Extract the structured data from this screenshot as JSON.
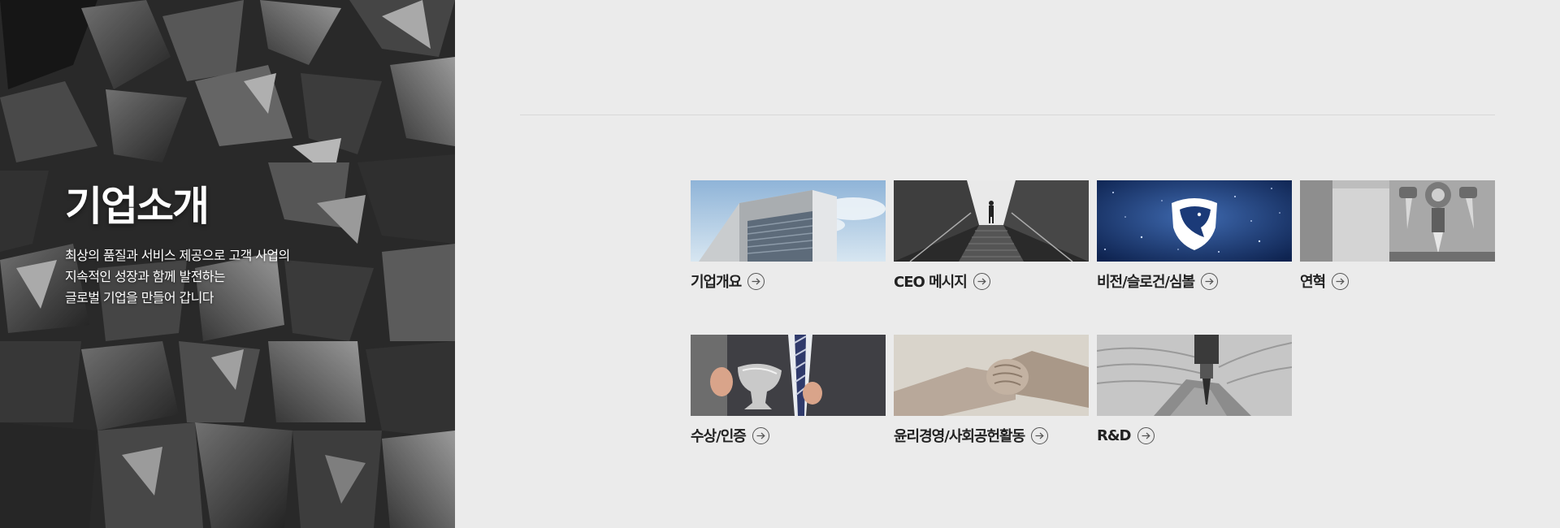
{
  "hero": {
    "title": "기업소개",
    "description_lines": [
      "최상의 품질과 서비스 제공으로 고객 사업의",
      "지속적인 성장과 함께 발전하는",
      "글로벌 기업을 만들어 갑니다"
    ]
  },
  "menu": {
    "items": [
      {
        "label": "기업개요",
        "image": "building-exterior"
      },
      {
        "label": "CEO 메시지",
        "image": "person-on-stairs"
      },
      {
        "label": "비전/슬로건/심볼",
        "image": "panther-shield-symbol"
      },
      {
        "label": "연혁",
        "image": "machining-tool"
      },
      {
        "label": "수상/인증",
        "image": "trophy-businessman"
      },
      {
        "label": "윤리경영/사회공헌활동",
        "image": "clasped-hands"
      },
      {
        "label": "R&D",
        "image": "drill-impeller"
      }
    ],
    "arrow_icon": "arrow-right-circle-icon"
  },
  "colors": {
    "background": "#ebebeb",
    "text": "#222222",
    "hero_text": "#ffffff"
  }
}
